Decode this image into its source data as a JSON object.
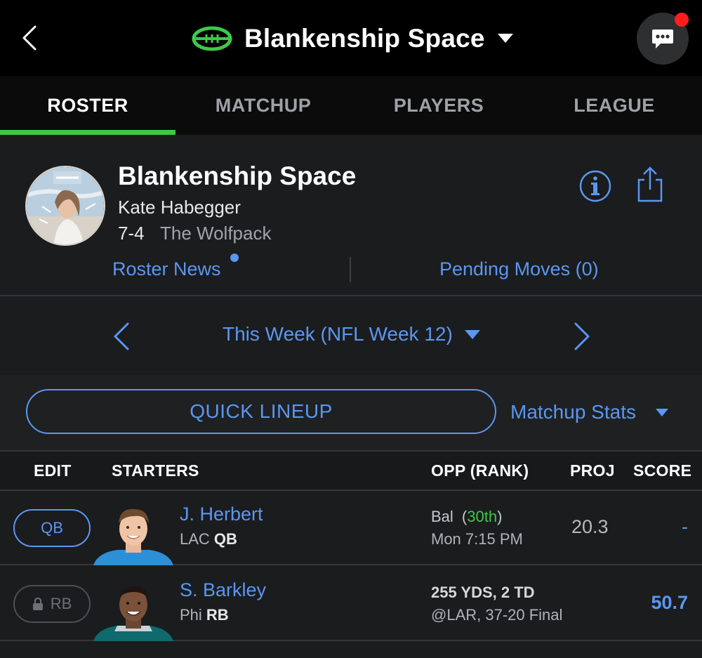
{
  "header": {
    "title": "Blankenship Space",
    "back_icon": "chevron-left-icon",
    "logo_icon": "football-icon",
    "caret_icon": "caret-down-icon",
    "chat_icon": "chat-bubble-icon",
    "accent_color": "#3ec84a",
    "notification_color": "#ff1d1d"
  },
  "tabs": [
    {
      "label": "ROSTER",
      "active": true
    },
    {
      "label": "MATCHUP",
      "active": false
    },
    {
      "label": "PLAYERS",
      "active": false
    },
    {
      "label": "LEAGUE",
      "active": false
    }
  ],
  "team": {
    "name": "Blankenship Space",
    "owner": "Kate Habegger",
    "record": "7-4",
    "division": "The Wolfpack",
    "info_icon": "info-icon",
    "share_icon": "share-icon"
  },
  "links": {
    "roster_news": "Roster News",
    "pending_moves": "Pending Moves (0)"
  },
  "week": {
    "label": "This Week (NFL Week 12)"
  },
  "controls": {
    "quick_lineup": "QUICK LINEUP",
    "matchup_stats": "Matchup Stats"
  },
  "table": {
    "headers": {
      "edit": "EDIT",
      "starters": "STARTERS",
      "opp": "OPP (RANK)",
      "proj": "PROJ",
      "score": "SCORE"
    },
    "rows": [
      {
        "slot": "QB",
        "locked": false,
        "name": "J. Herbert",
        "team": "LAC",
        "pos": "QB",
        "opp": "Bal",
        "rank": "30th",
        "game_time": "Mon 7:15 PM",
        "proj": "20.3",
        "score": "-"
      },
      {
        "slot": "RB",
        "locked": true,
        "name": "S. Barkley",
        "team": "Phi",
        "pos": "RB",
        "stat_line": "255 YDS, 2 TD",
        "result": "@LAR, 37-20 Final",
        "proj": "",
        "score": "50.7"
      }
    ]
  },
  "colors": {
    "link_blue": "#5a97f2",
    "background": "#1b1c1e",
    "rank_good": "#3ec84a"
  }
}
